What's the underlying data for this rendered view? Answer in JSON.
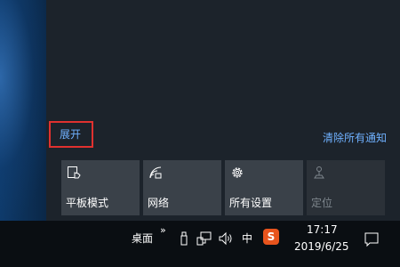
{
  "action_center": {
    "expand_label": "展开",
    "clear_all_label": "清除所有通知",
    "tiles": [
      {
        "label": "平板模式",
        "icon": "tablet-mode-icon",
        "enabled": true
      },
      {
        "label": "网络",
        "icon": "network-icon",
        "enabled": true
      },
      {
        "label": "所有设置",
        "icon": "gear-icon",
        "enabled": true
      },
      {
        "label": "定位",
        "icon": "location-icon",
        "enabled": false
      }
    ]
  },
  "taskbar": {
    "desktop_label": "桌面",
    "overflow_chevron": "»",
    "ime_label": "中",
    "sogou_label": "S",
    "time": "17:17",
    "date": "2019/6/25"
  },
  "colors": {
    "link": "#6fb1ff",
    "highlight_border": "#e0312f",
    "tile_bg": "#3a4149",
    "panel_bg": "#1c232b",
    "sogou": "#e8541d"
  }
}
